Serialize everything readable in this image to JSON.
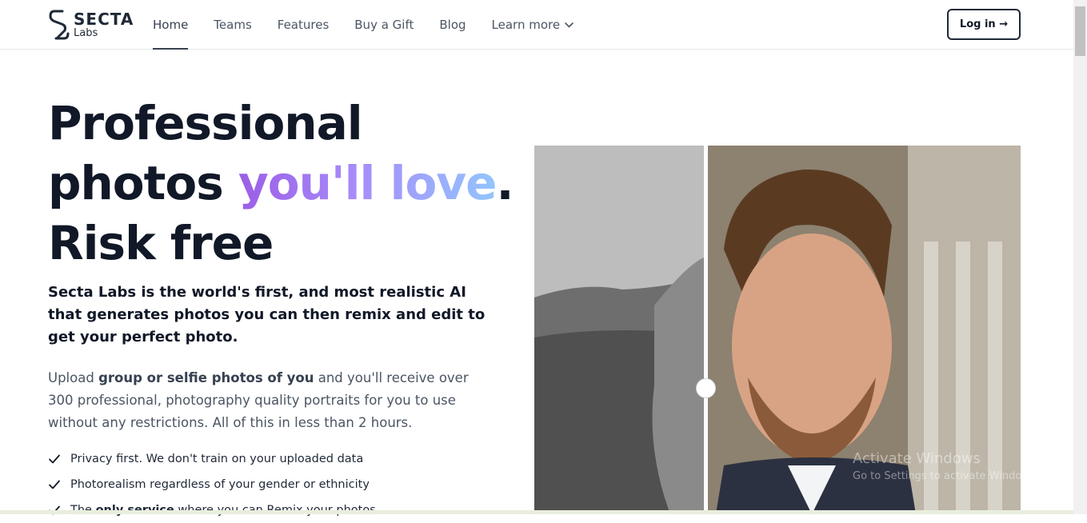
{
  "header": {
    "logo_main": "SECTA",
    "logo_sub": "Labs",
    "nav": [
      {
        "label": "Home",
        "active": true
      },
      {
        "label": "Teams"
      },
      {
        "label": "Features"
      },
      {
        "label": "Buy a Gift"
      },
      {
        "label": "Blog"
      },
      {
        "label": "Learn more",
        "dropdown": true
      }
    ],
    "login_label": "Log in →"
  },
  "hero": {
    "title_line1": "Professional",
    "title_line2_start": "photos ",
    "title_highlight": "you'll love",
    "title_line2_end": ".",
    "title_line3": "Risk free",
    "subtitle": "Secta Labs is the world's first, and most realistic AI that generates photos you can then remix and edit to get your perfect photo.",
    "desc_pre": "Upload ",
    "desc_bold": "group or selfie photos of you",
    "desc_post": " and you'll receive over 300 professional, photography quality portraits for you to use without any restrictions. All of this in less than 2 hours.",
    "features": [
      {
        "text": "Privacy first. We don't train on your uploaded data"
      },
      {
        "text": "Photorealism regardless of your gender or ethnicity"
      },
      {
        "pre": "The ",
        "bold": "only service",
        "post": " where you can Remix your photos"
      }
    ],
    "highlight_gradient": [
      "#9b5de5",
      "#93c5fd"
    ]
  },
  "watermark": {
    "line1": "Activate Windows",
    "line2": "Go to Settings to activate Windows."
  }
}
